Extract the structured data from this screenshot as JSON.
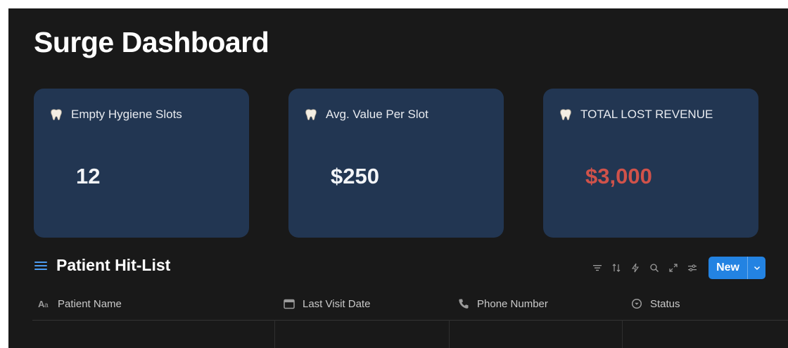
{
  "page": {
    "title": "Surge Dashboard"
  },
  "cards": [
    {
      "label": "Empty Hygiene Slots",
      "value": "12",
      "icon": "tooth-icon"
    },
    {
      "label": "Avg. Value Per Slot",
      "value": "$250",
      "icon": "tooth-icon"
    },
    {
      "label": "TOTAL LOST REVENUE",
      "value": "$3,000",
      "icon": "tooth-icon",
      "value_color": "#d0524a"
    }
  ],
  "section": {
    "title": "Patient Hit-List",
    "icon": "list-icon"
  },
  "toolbar": {
    "icons": [
      "filter-icon",
      "sort-icon",
      "automation-icon",
      "search-icon",
      "expand-icon",
      "settings-icon"
    ],
    "new_label": "New",
    "accent": "#2383e2"
  },
  "table": {
    "columns": [
      {
        "label": "Patient Name",
        "icon": "text-type-icon"
      },
      {
        "label": "Last Visit Date",
        "icon": "calendar-icon"
      },
      {
        "label": "Phone Number",
        "icon": "phone-icon"
      },
      {
        "label": "Status",
        "icon": "status-icon"
      }
    ]
  }
}
